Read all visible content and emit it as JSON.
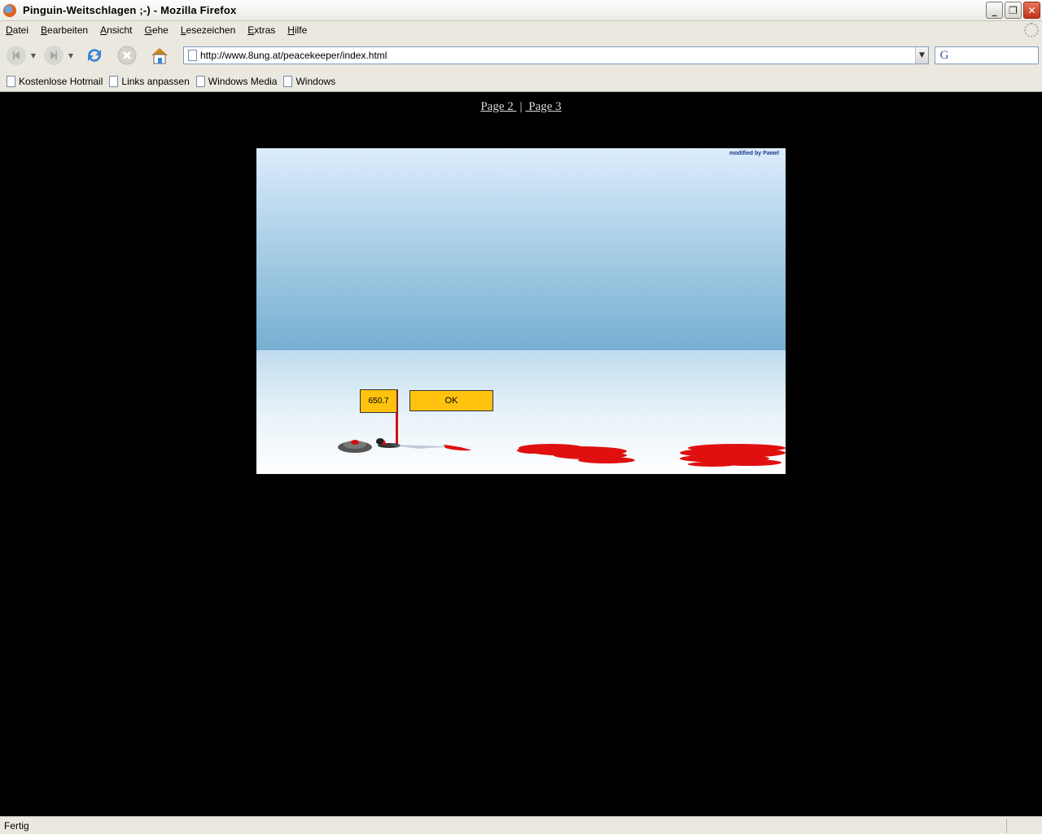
{
  "window": {
    "title": "Pinguin-Weitschlagen ;-) - Mozilla Firefox",
    "minimize": "_",
    "maximize": "❐",
    "close": "✕"
  },
  "menu": {
    "items": [
      {
        "underline": "D",
        "rest": "atei"
      },
      {
        "underline": "B",
        "rest": "earbeiten"
      },
      {
        "underline": "A",
        "rest": "nsicht"
      },
      {
        "underline": "G",
        "rest": "ehe"
      },
      {
        "underline": "L",
        "rest": "esezeichen"
      },
      {
        "underline": "E",
        "rest": "xtras"
      },
      {
        "underline": "H",
        "rest": "ilfe"
      }
    ]
  },
  "navbar": {
    "url": "http://www.8ung.at/peacekeeper/index.html",
    "search_engine": "G",
    "search_value": ""
  },
  "bookmarks": [
    {
      "label": "Kostenlose Hotmail"
    },
    {
      "label": "Links anpassen"
    },
    {
      "label": "Windows Media"
    },
    {
      "label": "Windows"
    }
  ],
  "content": {
    "link_page2": "Page 2 ",
    "separator": "|",
    "link_page3": " Page 3 "
  },
  "game": {
    "credit": "modified by Pawel",
    "score": "650.7",
    "ok_label": "OK"
  },
  "status": {
    "text": "Fertig"
  },
  "colors": {
    "chrome": "#ebe9df",
    "game_button": "#ffc20e",
    "blood": "#e01010"
  }
}
